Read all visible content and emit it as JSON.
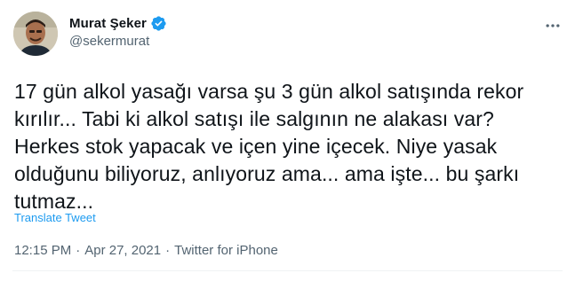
{
  "author": {
    "display_name": "Murat Şeker",
    "handle": "@sekermurat",
    "verified_icon": "verified-badge-icon"
  },
  "tweet": {
    "text": "17 gün alkol yasağı varsa şu 3 gün alkol satışında rekor\nkırılır... Tabi ki alkol satışı ile salgının ne alakası var?\nHerkes stok yapacak ve içen yine içecek. Niye yasak\nolduğunu biliyoruz, anlıyoruz ama... ama işte... bu şarkı\ntutmaz...",
    "translate_label": "Translate Tweet"
  },
  "meta": {
    "time": "12:15 PM",
    "separator": "·",
    "date": "Apr 27, 2021",
    "source": "Twitter for iPhone"
  },
  "colors": {
    "text": "#0f1419",
    "secondary": "#536471",
    "link": "#1d9bf0"
  },
  "icons": {
    "more": "more-horizontal-icon"
  }
}
